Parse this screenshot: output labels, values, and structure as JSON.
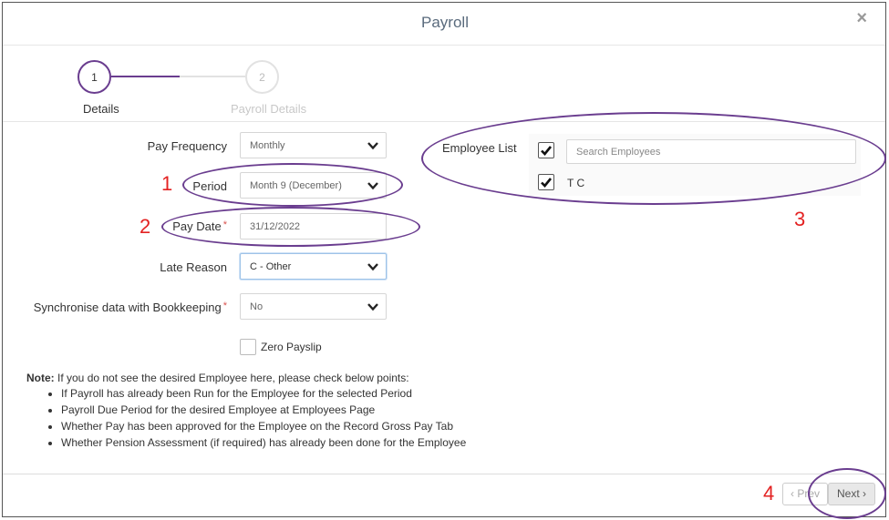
{
  "modal": {
    "title": "Payroll",
    "close_icon": "×"
  },
  "steps": [
    {
      "number": "1",
      "label": "Details"
    },
    {
      "number": "2",
      "label": "Payroll Details"
    }
  ],
  "form": {
    "pay_frequency": {
      "label": "Pay Frequency",
      "value": "Monthly"
    },
    "period": {
      "label": "Period",
      "value": "Month 9 (December)"
    },
    "pay_date": {
      "label": "Pay Date",
      "required": "*",
      "value": "31/12/2022"
    },
    "late_reason": {
      "label": "Late Reason",
      "value": "C - Other"
    },
    "sync_bookkeeping": {
      "label": "Synchronise data with Bookkeeping",
      "required": "*",
      "value": "No"
    },
    "zero_payslip": {
      "label": "Zero Payslip"
    }
  },
  "employee_list": {
    "label": "Employee List",
    "search_placeholder": "Search Employees",
    "employees": [
      {
        "name": "T C"
      }
    ]
  },
  "note": {
    "heading": "Note:",
    "text": " If you do not see the desired Employee here, please check below points:",
    "points": [
      "If Payroll has already been Run for the Employee for the selected Period",
      "Payroll Due Period for the desired Employee at Employees Page",
      "Whether Pay has been approved for the Employee on the Record Gross Pay Tab",
      "Whether Pension Assessment (if required) has already been done for the Employee"
    ]
  },
  "footer": {
    "prev_label": "‹ Prev",
    "next_label": "Next ›"
  },
  "annotations": {
    "a1": "1",
    "a2": "2",
    "a3": "3",
    "a4": "4"
  },
  "colors": {
    "accent": "#6a3d8f",
    "annotation": "#e32222",
    "title": "#5a6b7d"
  }
}
